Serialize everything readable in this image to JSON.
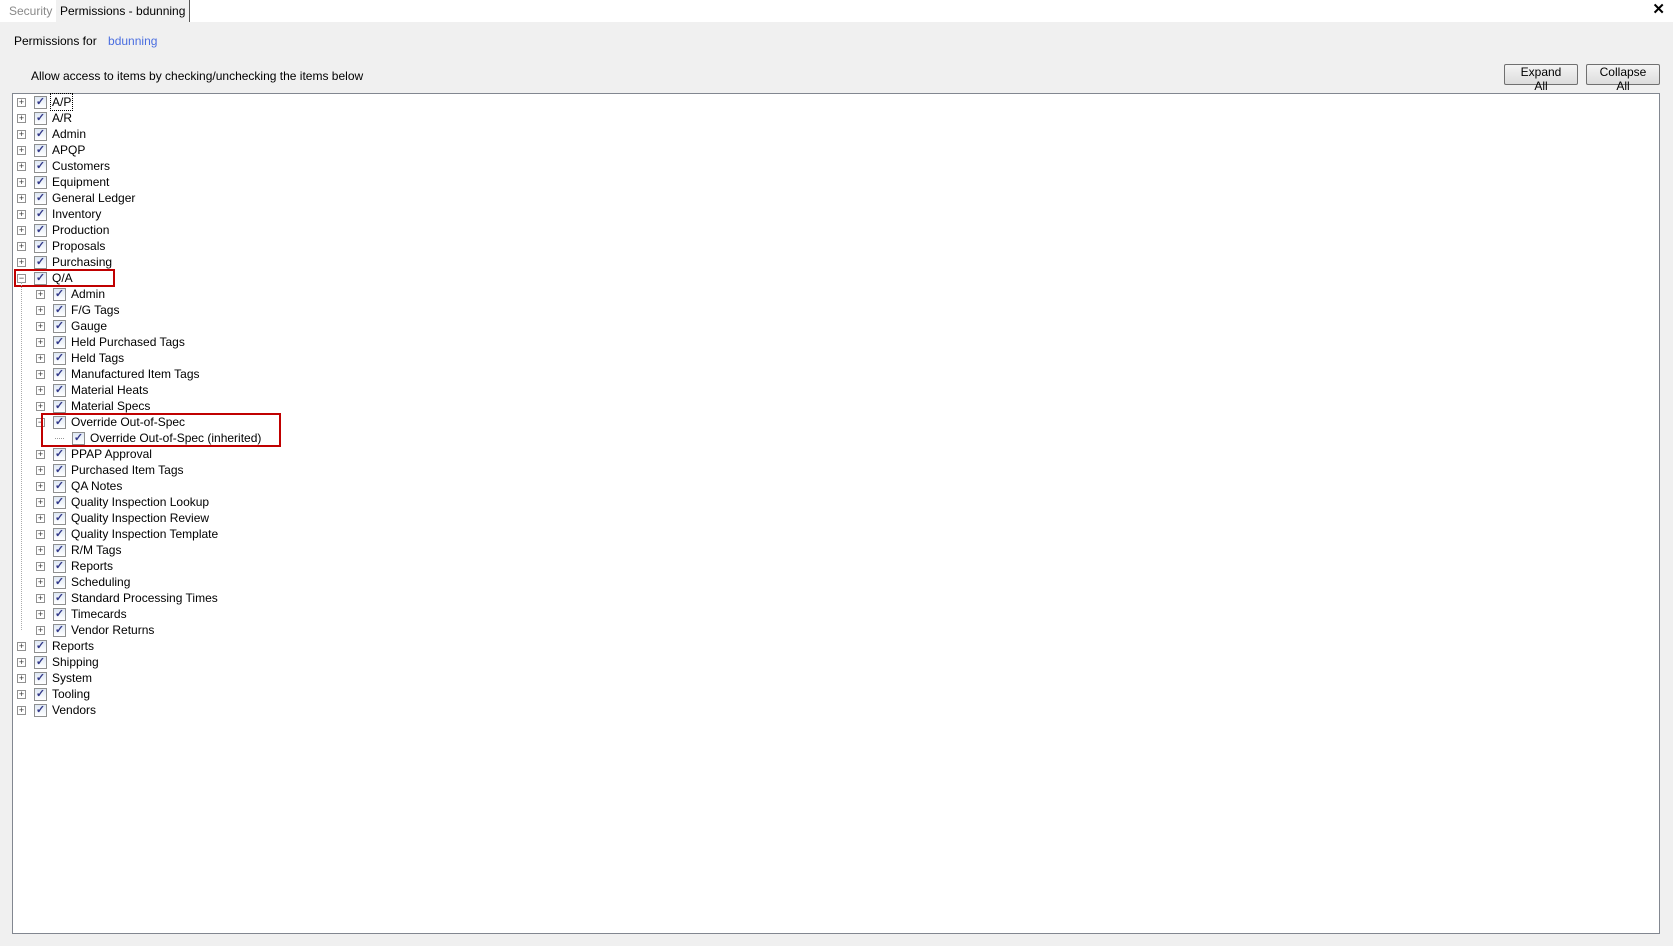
{
  "tabs": [
    {
      "label": "Security",
      "active": false
    },
    {
      "label": "Permissions - bdunning",
      "active": true
    }
  ],
  "header": {
    "permissions_for": "Permissions for",
    "user": "bdunning",
    "instructions": "Allow access to items by checking/unchecking the items below"
  },
  "toolbar": {
    "expand_all": "Expand All",
    "collapse_all": "Collapse All"
  },
  "colors": {
    "highlight": "#c00000",
    "link": "#4a6ee0"
  },
  "tree": [
    {
      "label": "A/P",
      "checked": true,
      "expanded": false
    },
    {
      "label": "A/R",
      "checked": true,
      "expanded": false
    },
    {
      "label": "Admin",
      "checked": true,
      "expanded": false
    },
    {
      "label": "APQP",
      "checked": true,
      "expanded": false
    },
    {
      "label": "Customers",
      "checked": true,
      "expanded": false
    },
    {
      "label": "Equipment",
      "checked": true,
      "expanded": false
    },
    {
      "label": "General Ledger",
      "checked": true,
      "expanded": false
    },
    {
      "label": "Inventory",
      "checked": true,
      "expanded": false
    },
    {
      "label": "Production",
      "checked": true,
      "expanded": false
    },
    {
      "label": "Proposals",
      "checked": true,
      "expanded": false
    },
    {
      "label": "Purchasing",
      "checked": true,
      "expanded": false
    },
    {
      "label": "Q/A",
      "checked": true,
      "expanded": true,
      "highlighted": true,
      "children": [
        {
          "label": "Admin",
          "checked": true
        },
        {
          "label": "F/G Tags",
          "checked": true
        },
        {
          "label": "Gauge",
          "checked": true
        },
        {
          "label": "Held Purchased Tags",
          "checked": true
        },
        {
          "label": "Held Tags",
          "checked": true
        },
        {
          "label": "Manufactured Item Tags",
          "checked": true
        },
        {
          "label": "Material Heats",
          "checked": true
        },
        {
          "label": "Material Specs",
          "checked": true
        },
        {
          "label": "Override Out-of-Spec",
          "checked": true,
          "expanded": true,
          "highlighted": true,
          "children": [
            {
              "label": "Override Out-of-Spec (inherited)",
              "checked": true
            }
          ]
        },
        {
          "label": "PPAP Approval",
          "checked": true
        },
        {
          "label": "Purchased Item Tags",
          "checked": true
        },
        {
          "label": "QA Notes",
          "checked": true
        },
        {
          "label": "Quality Inspection Lookup",
          "checked": true
        },
        {
          "label": "Quality Inspection Review",
          "checked": true
        },
        {
          "label": "Quality Inspection Template",
          "checked": true
        },
        {
          "label": "R/M Tags",
          "checked": true
        },
        {
          "label": "Reports",
          "checked": true
        },
        {
          "label": "Scheduling",
          "checked": true
        },
        {
          "label": "Standard Processing Times",
          "checked": true
        },
        {
          "label": "Timecards",
          "checked": true
        },
        {
          "label": "Vendor Returns",
          "checked": true
        }
      ]
    },
    {
      "label": "Reports",
      "checked": true,
      "expanded": false
    },
    {
      "label": "Shipping",
      "checked": true,
      "expanded": false
    },
    {
      "label": "System",
      "checked": true,
      "expanded": false
    },
    {
      "label": "Tooling",
      "checked": true,
      "expanded": false
    },
    {
      "label": "Vendors",
      "checked": true,
      "expanded": false
    }
  ]
}
